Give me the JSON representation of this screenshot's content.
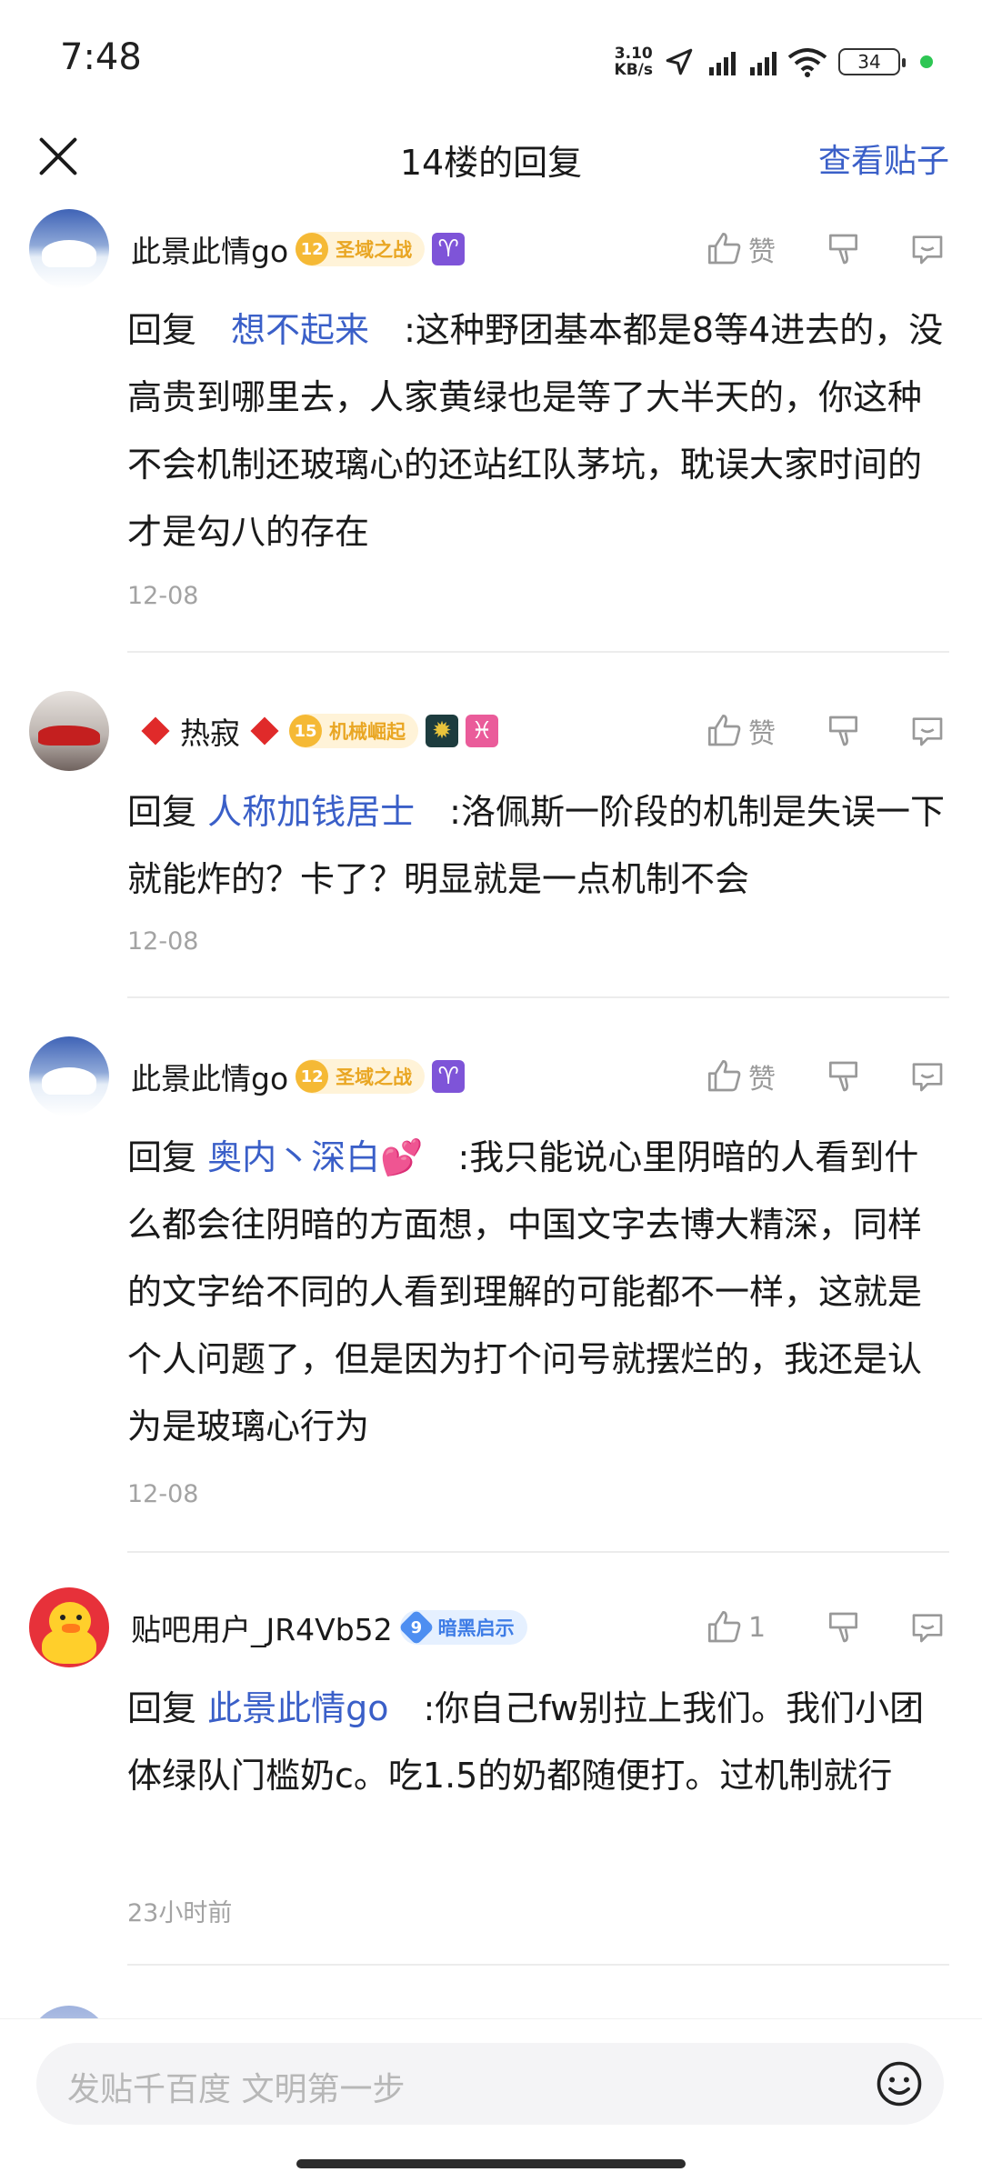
{
  "status_bar": {
    "time": "7:48",
    "net_speed_value": "3.10",
    "net_speed_unit": "KB/s",
    "battery": "34"
  },
  "header": {
    "title": "14楼的回复",
    "view_post": "查看贴子"
  },
  "posts": [
    {
      "username": "此景此情go",
      "level": "12",
      "title": "圣域之战",
      "like": "赞",
      "reply_to": "想不起来",
      "text": ":这种野团基本都是8等4进去的，没高贵到哪里去，人家黄绿也是等了大半天的，你这种不会机制还玻璃心的还站红队茅坑，耽误大家时间的才是勾八的存在",
      "date": "12-08"
    },
    {
      "username": "热寂",
      "level": "15",
      "title": "机械崛起",
      "like": "赞",
      "reply_to": "人称加钱居士",
      "text": ":洛佩斯一阶段的机制是失误一下就能炸的？卡了？明显就是一点机制不会",
      "date": "12-08"
    },
    {
      "username": "此景此情go",
      "level": "12",
      "title": "圣域之战",
      "like": "赞",
      "reply_to": "奥内丶深白💕",
      "text": ":我只能说心里阴暗的人看到什么都会往阴暗的方面想，中国文字去博大精深，同样的文字给不同的人看到理解的可能都不一样，这就是个人问题了，但是因为打个问号就摆烂的，我还是认为是玻璃心行为",
      "date": "12-08"
    },
    {
      "username": "贴吧用户_JR4Vb52",
      "level": "9",
      "title": "暗黑启示",
      "like": "1",
      "reply_to": "此景此情go",
      "text": ":你自己fw别拉上我们。我们小团体绿队门槛奶c。吃1.5的奶都随便打。过机制就行",
      "date": "23小时前"
    }
  ],
  "reply_prefix": "回复",
  "composer": {
    "placeholder": "发贴千百度 文明第一步"
  },
  "icons": {
    "close": "close-icon",
    "like": "thumb-up-icon",
    "dislike": "thumb-down-icon",
    "reply": "comment-icon",
    "emoji": "smiley-icon"
  }
}
